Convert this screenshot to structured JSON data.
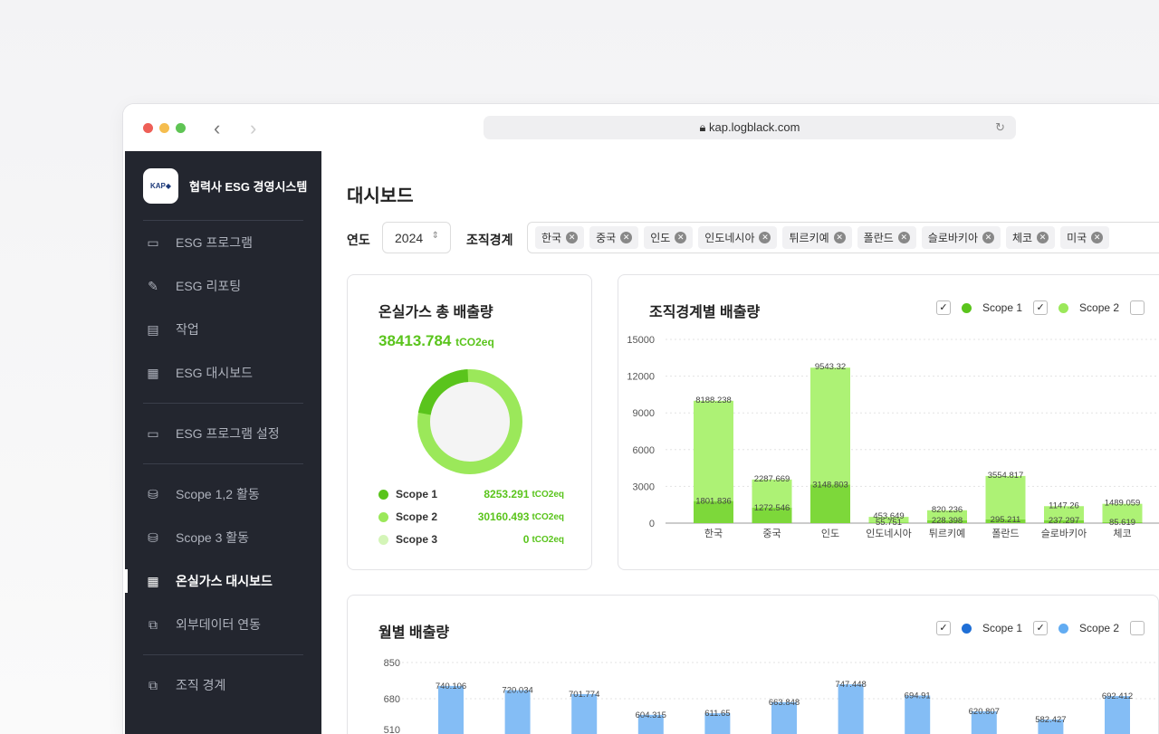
{
  "browser": {
    "url": "kap.logblack.com"
  },
  "sidebar": {
    "brand": "협력사 ESG 경영시스템",
    "logo": "KAP",
    "items": [
      {
        "label": "ESG 프로그램",
        "icon": "monitor-icon"
      },
      {
        "label": "ESG 리포팅",
        "icon": "pencil-icon"
      },
      {
        "label": "작업",
        "icon": "document-icon"
      },
      {
        "label": "ESG 대시보드",
        "icon": "grid-icon"
      },
      {
        "label": "ESG 프로그램 설정",
        "icon": "monitor-gear-icon"
      },
      {
        "label": "Scope 1,2 활동",
        "icon": "database-icon"
      },
      {
        "label": "Scope 3 활동",
        "icon": "database-icon"
      },
      {
        "label": "온실가스 대시보드",
        "icon": "grid-icon",
        "active": true
      },
      {
        "label": "외부데이터 연동",
        "icon": "link-icon"
      },
      {
        "label": "조직 경계",
        "icon": "org-icon"
      }
    ]
  },
  "page": {
    "title": "대시보드",
    "year_label": "연도",
    "year": "2024",
    "org_label": "조직경계",
    "orgs": [
      "한국",
      "중국",
      "인도",
      "인도네시아",
      "튀르키예",
      "폴란드",
      "슬로바키아",
      "체코",
      "미국"
    ]
  },
  "total": {
    "title": "온실가스 총 배출량",
    "value": "38413.784",
    "unit": "tCO2eq",
    "rows": [
      {
        "name": "Scope 1",
        "value": "8253.291",
        "unit": "tCO2eq",
        "color": "#5ac41c"
      },
      {
        "name": "Scope 2",
        "value": "30160.493",
        "unit": "tCO2eq",
        "color": "#9be85a"
      },
      {
        "name": "Scope 3",
        "value": "0",
        "unit": "tCO2eq",
        "color": "#d4f5b8"
      }
    ]
  },
  "chart_data": [
    {
      "type": "bar",
      "stacked": true,
      "title": "조직경계별 배출량",
      "legend": [
        "Scope 1",
        "Scope 2"
      ],
      "categories": [
        "한국",
        "중국",
        "인도",
        "인도네시아",
        "튀르키예",
        "폴란드",
        "슬로바키아",
        "체코"
      ],
      "series": [
        {
          "name": "Scope 1",
          "values": [
            1801.836,
            1272.546,
            3148.803,
            55.751,
            228.398,
            295.211,
            237.297,
            85.619
          ],
          "color": "#7dd83a"
        },
        {
          "name": "Scope 2",
          "values": [
            8188.238,
            2287.669,
            9543.32,
            453.649,
            820.236,
            3554.817,
            1147.26,
            1489.059
          ],
          "color": "#adf275"
        }
      ],
      "yticks": [
        "0",
        "3000",
        "6000",
        "9000",
        "12000",
        "15000"
      ],
      "ylim": [
        0,
        15000
      ]
    },
    {
      "type": "bar",
      "title": "월별 배출량",
      "legend": [
        "Scope 1",
        "Scope 2"
      ],
      "values": [
        740.106,
        720.034,
        701.774,
        604.315,
        611.65,
        663.848,
        747.448,
        694.91,
        620.807,
        582.427,
        692.412
      ],
      "color": "#84bdf5",
      "yticks": [
        "510",
        "680",
        "850"
      ],
      "ylim": [
        510,
        850
      ]
    }
  ]
}
